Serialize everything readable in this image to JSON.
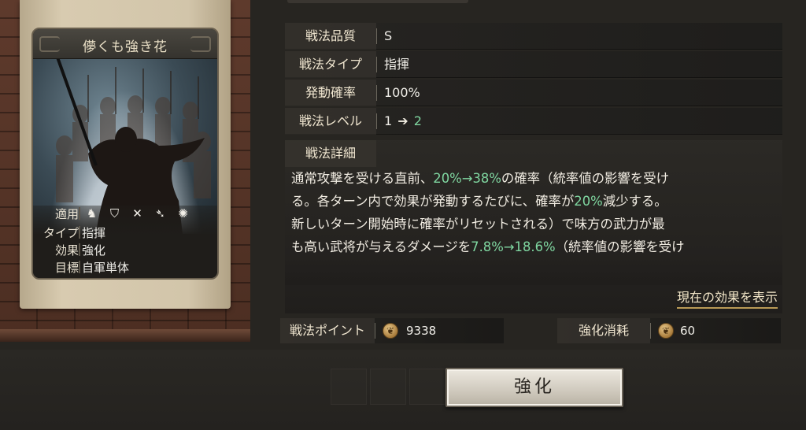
{
  "card": {
    "title": "儚くも強き花",
    "attributes": [
      {
        "key": "適用",
        "value": ""
      },
      {
        "key": "タイプ",
        "value": "指揮"
      },
      {
        "key": "効果",
        "value": "強化"
      },
      {
        "key": "目標",
        "value": "自軍単体"
      }
    ],
    "apply_icons": [
      "cavalry-icon",
      "shield-icon",
      "crossed-weapons-icon",
      "spear-icon",
      "wheel-icon"
    ]
  },
  "stats": {
    "quality": {
      "label": "戦法品質",
      "value": "S"
    },
    "type": {
      "label": "戦法タイプ",
      "value": "指揮"
    },
    "rate": {
      "label": "発動確率",
      "value": "100%"
    },
    "level": {
      "label": "戦法レベル",
      "from": "1",
      "arrow": "➔",
      "to": "2"
    }
  },
  "detail": {
    "label": "戦法詳細",
    "line1_a": "通常攻撃を受ける直前、",
    "line1_b": "20%→38%",
    "line1_c": "の確率（統率値の影響を受け",
    "line2_a": "る。各ターン内で効果が発動するたびに、確率が",
    "line2_b": "20%",
    "line2_c": "減少する。",
    "line3": "新しいターン開始時に確率がリセットされる）で味方の武力が最",
    "line4_a": "も高い武将が与えるダメージを",
    "line4_b": "7.8%→18.6%",
    "line4_c": "（統率値の影響を受け",
    "show_effect": "現在の効果を表示"
  },
  "points": {
    "label": "戦法ポイント",
    "value": "9338",
    "cost_label": "強化消耗",
    "cost_value": "60"
  },
  "upgrade_button": "強化",
  "colors": {
    "highlight": "#7fd6a0",
    "gold": "#b99a56"
  }
}
